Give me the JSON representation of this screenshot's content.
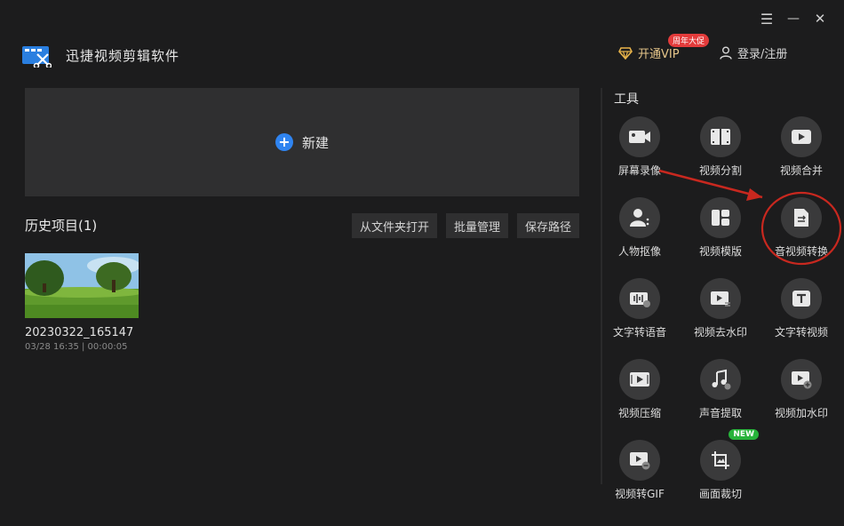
{
  "app": {
    "title": "迅捷视频剪辑软件"
  },
  "window_controls": {
    "menu": "☰",
    "minimize": "—",
    "close": "✕"
  },
  "header": {
    "vip_label": "开通VIP",
    "vip_badge": "周年大促",
    "login_label": "登录/注册"
  },
  "main": {
    "new_label": "新建",
    "history_title": "历史项目(1)",
    "actions": [
      "从文件夹打开",
      "批量管理",
      "保存路径"
    ],
    "projects": [
      {
        "name": "20230322_165147",
        "meta": "03/28 16:35 | 00:00:05"
      }
    ]
  },
  "tools": {
    "title": "工具",
    "items": [
      {
        "label": "屏幕录像",
        "icon": "camera-icon"
      },
      {
        "label": "视频分割",
        "icon": "film-split-icon"
      },
      {
        "label": "视频合并",
        "icon": "play-merge-icon"
      },
      {
        "label": "人物抠像",
        "icon": "person-cutout-icon"
      },
      {
        "label": "视频模版",
        "icon": "template-icon"
      },
      {
        "label": "音视频转换",
        "icon": "convert-icon"
      },
      {
        "label": "文字转语音",
        "icon": "text-to-speech-icon"
      },
      {
        "label": "视频去水印",
        "icon": "remove-watermark-icon"
      },
      {
        "label": "文字转视频",
        "icon": "text-to-video-icon"
      },
      {
        "label": "视频压缩",
        "icon": "compress-icon"
      },
      {
        "label": "声音提取",
        "icon": "audio-extract-icon"
      },
      {
        "label": "视频加水印",
        "icon": "add-watermark-icon"
      },
      {
        "label": "视频转GIF",
        "icon": "gif-icon"
      },
      {
        "label": "画面裁切",
        "icon": "crop-icon"
      }
    ],
    "new_tag": "NEW"
  },
  "colors": {
    "accent_blue": "#2f84f0",
    "annotation_red": "#c8281f",
    "vip_gold": "#e6c68a"
  }
}
